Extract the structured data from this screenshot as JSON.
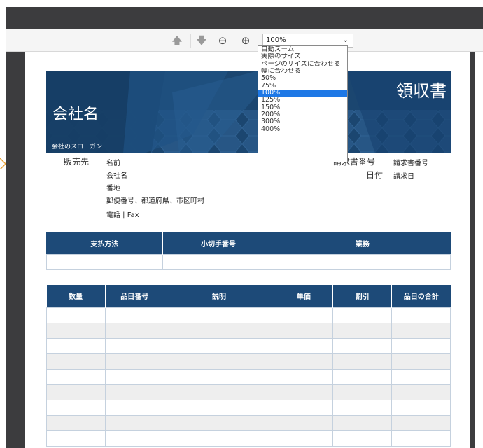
{
  "toolbar": {
    "zoom_value": "100%",
    "icons": [
      "arrow-up-icon",
      "arrow-down-icon",
      "zoom-out-icon",
      "zoom-in-icon",
      "chevron-down-icon"
    ]
  },
  "zoom_options": [
    "自動ズーム",
    "実際のサイズ",
    "ページのサイズに合わせる",
    "幅に合わせる",
    "50%",
    "75%",
    "100%",
    "125%",
    "150%",
    "200%",
    "300%",
    "400%"
  ],
  "zoom_selected": "100%",
  "document": {
    "company_name": "会社名",
    "slogan": "会社のスローガン",
    "title": "領収書",
    "seller_label": "販売先",
    "seller_lines": [
      "名前",
      "会社名",
      "番地",
      "郵便番号、都道府県、市区町村",
      "電話 | Fax"
    ],
    "invoice_number_label": "請求書番号",
    "invoice_number_value": "請求書番号",
    "date_label": "日付",
    "date_value": "請求日",
    "payment_table": {
      "headers": [
        "支払方法",
        "小切手番号",
        "業務"
      ]
    },
    "items_table": {
      "headers": [
        "数量",
        "品目番号",
        "説明",
        "単価",
        "割引",
        "品目の合計"
      ]
    }
  },
  "colors": {
    "header_blue": "#1b4670",
    "table_header_blue": "#1d4a78",
    "selected_option": "#1e78e6",
    "viewer_background": "#3c3c3e"
  }
}
